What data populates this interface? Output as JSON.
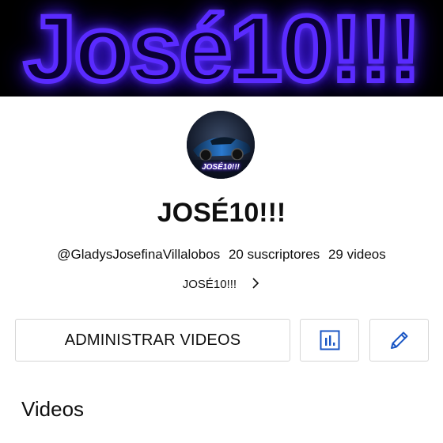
{
  "banner": {
    "text": "José10!!!"
  },
  "avatar": {
    "text": "JOSÉ10!!!"
  },
  "channel": {
    "name": "JOSÉ10!!!",
    "handle": "@GladysJosefinaVillalobos",
    "subscribers": "20 suscriptores",
    "videos_count": "29 videos",
    "description": "JOSÉ10!!!"
  },
  "actions": {
    "manage_label": "ADMINISTRAR VIDEOS",
    "analytics_icon": "analytics-icon",
    "edit_icon": "pencil-icon"
  },
  "sections": {
    "videos_title": "Videos"
  },
  "colors": {
    "banner_glow": "#5a2bff",
    "icon_blue": "#1a56c4",
    "border": "#d6d6d6"
  }
}
